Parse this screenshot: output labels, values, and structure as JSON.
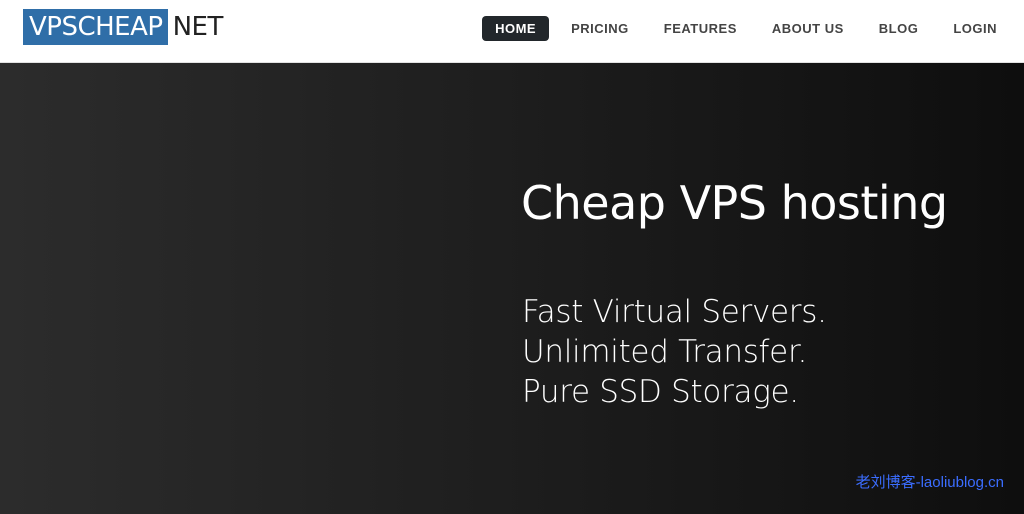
{
  "header": {
    "logo": {
      "primary": "VPSCHEAP",
      "secondary": "NET"
    },
    "nav": [
      {
        "label": "HOME",
        "active": true
      },
      {
        "label": "PRICING",
        "active": false
      },
      {
        "label": "FEATURES",
        "active": false
      },
      {
        "label": "ABOUT US",
        "active": false
      },
      {
        "label": "BLOG",
        "active": false
      },
      {
        "label": "LOGIN",
        "active": false
      }
    ]
  },
  "hero": {
    "title": "Cheap VPS hosting",
    "lines": [
      "Fast Virtual Servers.",
      "Unlimited Transfer.",
      "Pure SSD Storage."
    ]
  },
  "watermark": "老刘博客-laoliublog.cn",
  "colors": {
    "brand": "#2f6ea8",
    "nav_active_bg": "#22272b",
    "hero_bg": "#1c1c1c",
    "watermark": "#3b6dff"
  }
}
